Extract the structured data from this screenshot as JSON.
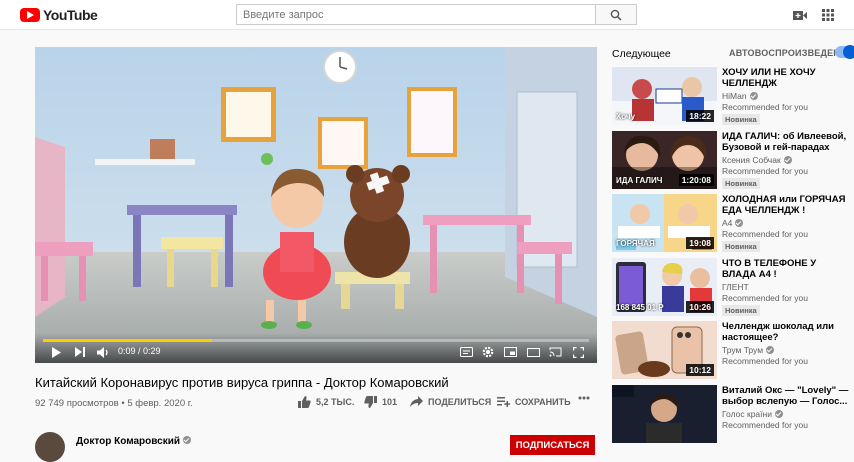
{
  "header": {
    "logo_text": "YouTube",
    "search_placeholder": "Введите запрос"
  },
  "player": {
    "time": "0:09 / 0:29",
    "progress": 0.31
  },
  "video": {
    "title": "Китайский Коронавирус против вируса гриппа - Доктор Комаровский",
    "views_date": "92 749 просмотров • 5 февр. 2020 г.",
    "likes": "5,2 ТЫС.",
    "dislikes": "101",
    "share_label": "ПОДЕЛИТЬСЯ",
    "save_label": "СОХРАНИТЬ",
    "channel": "Доктор Комаровский",
    "subscribe_label": "ПОДПИСАТЬСЯ"
  },
  "sidebar": {
    "up_next": "Следующее",
    "autoplay": "АВТОВОСПРОИЗВЕДЕНИЕ",
    "items": [
      {
        "title": "ХОЧУ ИЛИ НЕ ХОЧУ ЧЕЛЛЕНДЖ",
        "channel": "HiMan",
        "verified": true,
        "reco": "Recommended for you",
        "badge": "Новинка",
        "duration": "18:22",
        "thumb_text": "Хочу"
      },
      {
        "title": "ИДА ГАЛИЧ: об Ивлеевой, Бузовой и гей-парадах",
        "channel": "Ксения Собчак",
        "verified": true,
        "reco": "Recommended for you",
        "badge": "Новинка",
        "duration": "1:20:08",
        "thumb_text": "ИДА ГАЛИЧ"
      },
      {
        "title": "ХОЛОДНАЯ или ГОРЯЧАЯ ЕДА ЧЕЛЛЕНДЖ !",
        "channel": "A4",
        "verified": true,
        "reco": "Recommended for you",
        "badge": "Новинка",
        "duration": "19:08",
        "thumb_text": "ГОРЯЧАЯ"
      },
      {
        "title": "ЧТО В ТЕЛЕФОНЕ У ВЛАДА А4 !",
        "channel": "ГЛЕНТ",
        "verified": false,
        "reco": "Recommended for you",
        "badge": "Новинка",
        "duration": "10:26",
        "thumb_text": "168 845 01 Р"
      },
      {
        "title": "Челлендж шоколад или настоящее?",
        "channel": "Трум Трум",
        "verified": true,
        "reco": "Recommended for you",
        "badge": "",
        "duration": "10:12",
        "thumb_text": ""
      },
      {
        "title": "Виталий Окс — \"Lovely\" — выбор вслепую — Голос...",
        "channel": "Голос країни",
        "verified": true,
        "reco": "Recommended for you",
        "badge": "",
        "duration": "",
        "thumb_text": ""
      }
    ]
  },
  "colors": {
    "brand_red": "#ff0000",
    "progress": "#ffcc00",
    "subscribe": "#cc0000",
    "toggle": "#065fd4"
  }
}
